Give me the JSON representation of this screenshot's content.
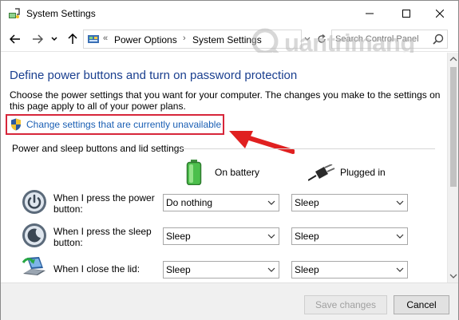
{
  "window": {
    "title": "System Settings"
  },
  "navbar": {
    "crumb_sep": "«",
    "crumb_arrow": "›",
    "breadcrumbs": [
      "Power Options",
      "System Settings"
    ],
    "search_placeholder": "Search Control Panel"
  },
  "watermark": {
    "text": "uantrimang"
  },
  "content": {
    "title": "Define power buttons and turn on password protection",
    "description": "Choose the power settings that you want for your computer. The changes you make to the settings on this page apply to all of your power plans.",
    "change_link": "Change settings that are currently unavailable",
    "section_title": "Power and sleep buttons and lid settings",
    "columns": {
      "battery": "On battery",
      "plugged": "Plugged in"
    },
    "rows": [
      {
        "label": "When I press the power button:",
        "battery": "Do nothing",
        "plugged": "Sleep",
        "icon": "power-button-icon"
      },
      {
        "label": "When I press the sleep button:",
        "battery": "Sleep",
        "plugged": "Sleep",
        "icon": "sleep-button-icon"
      },
      {
        "label": "When I close the lid:",
        "battery": "Sleep",
        "plugged": "Sleep",
        "icon": "laptop-lid-icon"
      }
    ]
  },
  "footer": {
    "save_label": "Save changes",
    "cancel_label": "Cancel"
  },
  "colors": {
    "title_blue": "#1a3f8f",
    "link_blue": "#1a5fb4",
    "highlight_red": "#d7263a"
  }
}
